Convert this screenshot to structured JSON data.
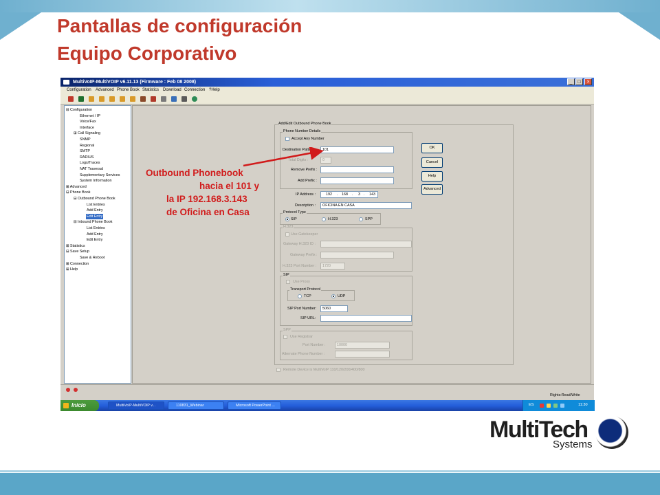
{
  "slide": {
    "title_line1": "Pantallas de configuración",
    "title_line2": "Equipo Corporativo",
    "title_color": "#c0392b",
    "accent_color": "#5aa6c8"
  },
  "window": {
    "title": "MultiVoIP-MultiVOIP v6.11.13 (Firmware : Feb 08 2008)",
    "minimize_label": "_",
    "maximize_label": "□",
    "close_label": "×"
  },
  "menu": [
    "Configuration",
    "Advanced",
    "Phone Book",
    "Statistics",
    "Download",
    "Connection",
    "?Help"
  ],
  "toolbar_icons": [
    "network-icon",
    "monitor-icon",
    "phonebook-icon",
    "phonebook-icon",
    "phonebook-icon",
    "phonebook-icon",
    "phonebook-icon",
    "tools-icon",
    "upload-icon",
    "download-icon",
    "reboot-icon",
    "printer-icon",
    "globe-icon"
  ],
  "tree": [
    {
      "label": "Configuration",
      "toggle": "⊟"
    },
    {
      "label": "Ethernet / IP"
    },
    {
      "label": "Voice/Fax"
    },
    {
      "label": "Interface"
    },
    {
      "label": "Call Signaling",
      "toggle": "⊞"
    },
    {
      "label": "SNMP"
    },
    {
      "label": "Regional"
    },
    {
      "label": "SMTP"
    },
    {
      "label": "RADIUS"
    },
    {
      "label": "Logs/Traces"
    },
    {
      "label": "NAT Traversal"
    },
    {
      "label": "Supplementary Services"
    },
    {
      "label": "System Information"
    },
    {
      "label": "Advanced",
      "toggle": "⊞"
    },
    {
      "label": "Phone Book",
      "toggle": "⊟"
    },
    {
      "label": "Outbound Phone Book",
      "toggle": "⊟"
    },
    {
      "label": "List Entries"
    },
    {
      "label": "Add Entry"
    },
    {
      "label": "Edit Entry",
      "selected": true
    },
    {
      "label": "Inbound Phone Book",
      "toggle": "⊟"
    },
    {
      "label": "List Entries"
    },
    {
      "label": "Add Entry"
    },
    {
      "label": "Edit Entry"
    },
    {
      "label": "Statistics",
      "toggle": "⊞"
    },
    {
      "label": "Save Setup",
      "toggle": "⊟"
    },
    {
      "label": "Save & Reboot"
    },
    {
      "label": "Connection",
      "toggle": "⊞"
    },
    {
      "label": "Help",
      "toggle": "⊞"
    }
  ],
  "form": {
    "group_title": "Add/Edit Outbound Phone Book",
    "phone_details": {
      "legend": "Phone Number Details",
      "accept_any_label": "Accept Any Number",
      "destination_pattern_label": "Destination Pattern :",
      "destination_pattern_value": "101",
      "total_digits_label": "Total Digits :",
      "total_digits_value": "0",
      "remove_prefix_label": "Remove Prefix :",
      "remove_prefix_value": "",
      "add_prefix_label": "Add Prefix :",
      "add_prefix_value": ""
    },
    "ip_address_label": "IP Address :",
    "ip_octets": [
      "192",
      "168",
      "3",
      "143"
    ],
    "ip_sep": ".",
    "description_label": "Description :",
    "description_value": "OFICINA EN CASA",
    "protocol": {
      "legend": "Protocol Type",
      "options": [
        "SIP",
        "H.323",
        "SPP"
      ],
      "selected": "SIP"
    },
    "h323": {
      "legend": "H.323",
      "use_gatekeeper_label": "Use Gatekeeper",
      "gateway_id_label": "Gateway H.323 ID :",
      "gateway_prefix_label": "Gateway Prefix :",
      "port_label": "H.323 Port Number :",
      "port_value": "1720"
    },
    "sip": {
      "legend": "SIP",
      "use_proxy_label": "Use Proxy",
      "transport_legend": "Transport Protocol",
      "tcp_label": "TCP",
      "udp_label": "UDP",
      "selected_transport": "UDP",
      "port_label": "SIP Port Number:",
      "port_value": "5060",
      "url_label": "SIP URL:",
      "url_value": ""
    },
    "spp": {
      "legend": "SPP",
      "use_registrar_label": "Use Registrar",
      "port_label": "Port Number :",
      "port_value": "10000",
      "alt_phone_label": "Alternate Phone Number :"
    },
    "remote_device_label": "Remote Device is MultiVoIP 110/120/200/400/800"
  },
  "buttons": {
    "ok": "OK",
    "cancel": "Cancel",
    "help": "Help",
    "advanced": "Advanced"
  },
  "status": {
    "rights": "Rights:Read/Write"
  },
  "taskbar": {
    "start_label": "Inicio",
    "tasks": [
      "MultiVoIP-MultiVOIP v...",
      "110831_Webinar",
      "Microsoft PowerPoint ..."
    ],
    "tray_lang": "ES",
    "clock": "11:30"
  },
  "annotation": {
    "line1": "Outbound Phonebook",
    "line2": "hacia el 101 y",
    "line3": "la IP 192.168.3.143",
    "line4": "de Oficina en Casa",
    "color": "#d11a1a"
  },
  "logo": {
    "word1": "Multi",
    "word2": "Tech",
    "word3": "Systems"
  }
}
